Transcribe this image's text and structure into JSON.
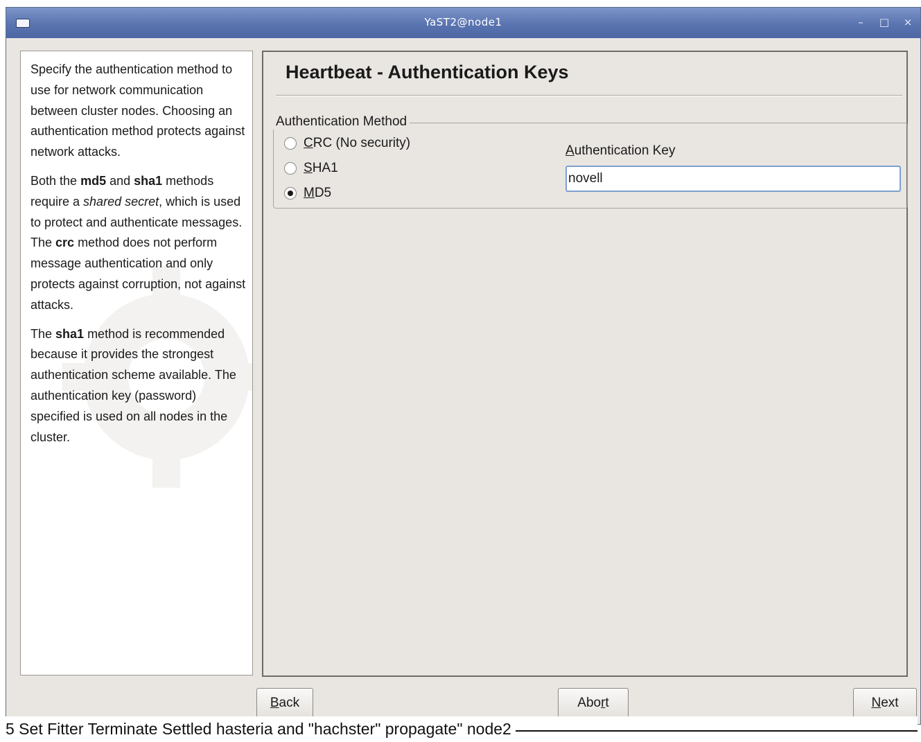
{
  "window": {
    "title": "YaST2@node1",
    "minimize_glyph": "–",
    "maximize_glyph": "□",
    "close_glyph": "×"
  },
  "help": {
    "p1": "Specify the authentication method to use for network communication between cluster nodes. Choosing an authentication method protects against network attacks.",
    "p2_prefix": "Both the ",
    "p2_md5": "md5",
    "p2_and": " and ",
    "p2_sha1": "sha1",
    "p2_mid": " methods require a ",
    "p2_shared_secret": "shared secret",
    "p2_rest": ", which is used to protect and authenticate messages. The ",
    "p2_crc": "crc",
    "p2_end": " method does not perform message authentication and only protects against corruption, not against attacks.",
    "p3_prefix": "The ",
    "p3_sha1": "sha1",
    "p3_rest": " method is recommended because it provides the strongest authentication scheme available. The authentication key (password) specified is used on all nodes in the cluster."
  },
  "main": {
    "heading": "Heartbeat - Authentication Keys",
    "group_title": "Authentication Method",
    "options": [
      {
        "mnemonic": "C",
        "rest": "RC (No security)",
        "selected": false
      },
      {
        "mnemonic": "S",
        "rest": "HA1",
        "selected": false
      },
      {
        "mnemonic": "M",
        "rest": "D5",
        "selected": true
      }
    ],
    "key_label_mnemonic": "A",
    "key_label_rest": "uthentication Key",
    "key_value": "novell"
  },
  "buttons": {
    "back_mnemonic": "B",
    "back_rest": "ack",
    "abort_start": "Abo",
    "abort_mnemonic": "r",
    "abort_end": "t",
    "next_mnemonic": "N",
    "next_rest": "ext"
  },
  "caption": {
    "text": "5  Set Fitter Terminate Settled hasteria and  \"hachster\" propagate\"  node2"
  },
  "colors": {
    "titlebar": "#5a74b0",
    "window_bg": "#e9e6e2",
    "input_focus_border": "#7e9fd0"
  }
}
